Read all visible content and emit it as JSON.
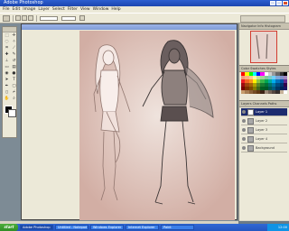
{
  "window": {
    "title": "Adobe Photoshop"
  },
  "menu": {
    "items": [
      "File",
      "Edit",
      "Image",
      "Layer",
      "Select",
      "Filter",
      "View",
      "Window",
      "Help"
    ]
  },
  "toolbox": {
    "tools": [
      {
        "icon": "marquee-icon",
        "glyph": "⬚"
      },
      {
        "icon": "move-icon",
        "glyph": "✛"
      },
      {
        "icon": "lasso-icon",
        "glyph": "◌"
      },
      {
        "icon": "magic-wand-icon",
        "glyph": "✧"
      },
      {
        "icon": "crop-icon",
        "glyph": "⌗"
      },
      {
        "icon": "slice-icon",
        "glyph": "⟋"
      },
      {
        "icon": "healing-brush-icon",
        "glyph": "✚"
      },
      {
        "icon": "brush-icon",
        "glyph": "✎"
      },
      {
        "icon": "clone-stamp-icon",
        "glyph": "⊥"
      },
      {
        "icon": "history-brush-icon",
        "glyph": "↺"
      },
      {
        "icon": "eraser-icon",
        "glyph": "▭"
      },
      {
        "icon": "gradient-icon",
        "glyph": "▤"
      },
      {
        "icon": "blur-icon",
        "glyph": "◉"
      },
      {
        "icon": "dodge-icon",
        "glyph": "●"
      },
      {
        "icon": "path-select-icon",
        "glyph": "➤"
      },
      {
        "icon": "type-icon",
        "glyph": "T"
      },
      {
        "icon": "pen-icon",
        "glyph": "✒"
      },
      {
        "icon": "shape-icon",
        "glyph": "▢"
      },
      {
        "icon": "notes-icon",
        "glyph": "▯"
      },
      {
        "icon": "eyedropper-icon",
        "glyph": "⌿"
      },
      {
        "icon": "hand-icon",
        "glyph": "✋"
      },
      {
        "icon": "zoom-icon",
        "glyph": "⌕"
      }
    ],
    "foreground_color": "#000000",
    "background_color": "#ffffff"
  },
  "navigator": {
    "tabs": [
      "Navigator",
      "Info",
      "Histogram"
    ]
  },
  "swatches": {
    "tabs": [
      "Color",
      "Swatches",
      "Styles"
    ],
    "colors": [
      "#ff0000",
      "#ffff00",
      "#00ff00",
      "#00ffff",
      "#0000ff",
      "#ff00ff",
      "#ffffff",
      "#cccccc",
      "#999999",
      "#666666",
      "#333333",
      "#000000",
      "#f7977a",
      "#fbad82",
      "#fdc68c",
      "#fff799",
      "#c4df9b",
      "#a3d39c",
      "#82ca9c",
      "#7accc8",
      "#6ecff6",
      "#7ea7d8",
      "#8493ca",
      "#a187be",
      "#ed1c24",
      "#f26522",
      "#f7941d",
      "#fff200",
      "#8dc63f",
      "#39b54a",
      "#00a651",
      "#00a99d",
      "#00aeef",
      "#0072bc",
      "#0054a6",
      "#662d91",
      "#9e0b0f",
      "#a0410d",
      "#a36209",
      "#aba000",
      "#598527",
      "#1a7b30",
      "#007236",
      "#00746b",
      "#0076a3",
      "#004b80",
      "#003471",
      "#32004b",
      "#790000",
      "#7b2e00",
      "#7d4900",
      "#827b00",
      "#406618",
      "#005e20",
      "#005826",
      "#005952",
      "#005b7f",
      "#003663",
      "#002157",
      "#1b1464",
      "#c69c6d",
      "#a67c52",
      "#8c6239",
      "#754c24",
      "#603913",
      "#3c2415",
      "#998675",
      "#736357",
      "#534741",
      "#362f2d",
      "#c7b299",
      "#ffffff"
    ]
  },
  "layers": {
    "tabs": [
      "Layers",
      "Channels",
      "Paths"
    ],
    "items": [
      {
        "name": "Layer 1",
        "active": true
      },
      {
        "name": "Layer 2",
        "active": false
      },
      {
        "name": "Layer 3",
        "active": false
      },
      {
        "name": "Layer 4",
        "active": false
      },
      {
        "name": "Background",
        "active": false
      }
    ]
  },
  "taskbar": {
    "start_label": "start",
    "tasks": [
      {
        "label": "Adobe Photoshop",
        "active": true
      },
      {
        "label": "Untitled - Notepad",
        "active": false
      },
      {
        "label": "Windows Explorer",
        "active": false
      },
      {
        "label": "Internet Explorer",
        "active": false
      },
      {
        "label": "Paint",
        "active": false
      }
    ],
    "clock": "12:00"
  }
}
